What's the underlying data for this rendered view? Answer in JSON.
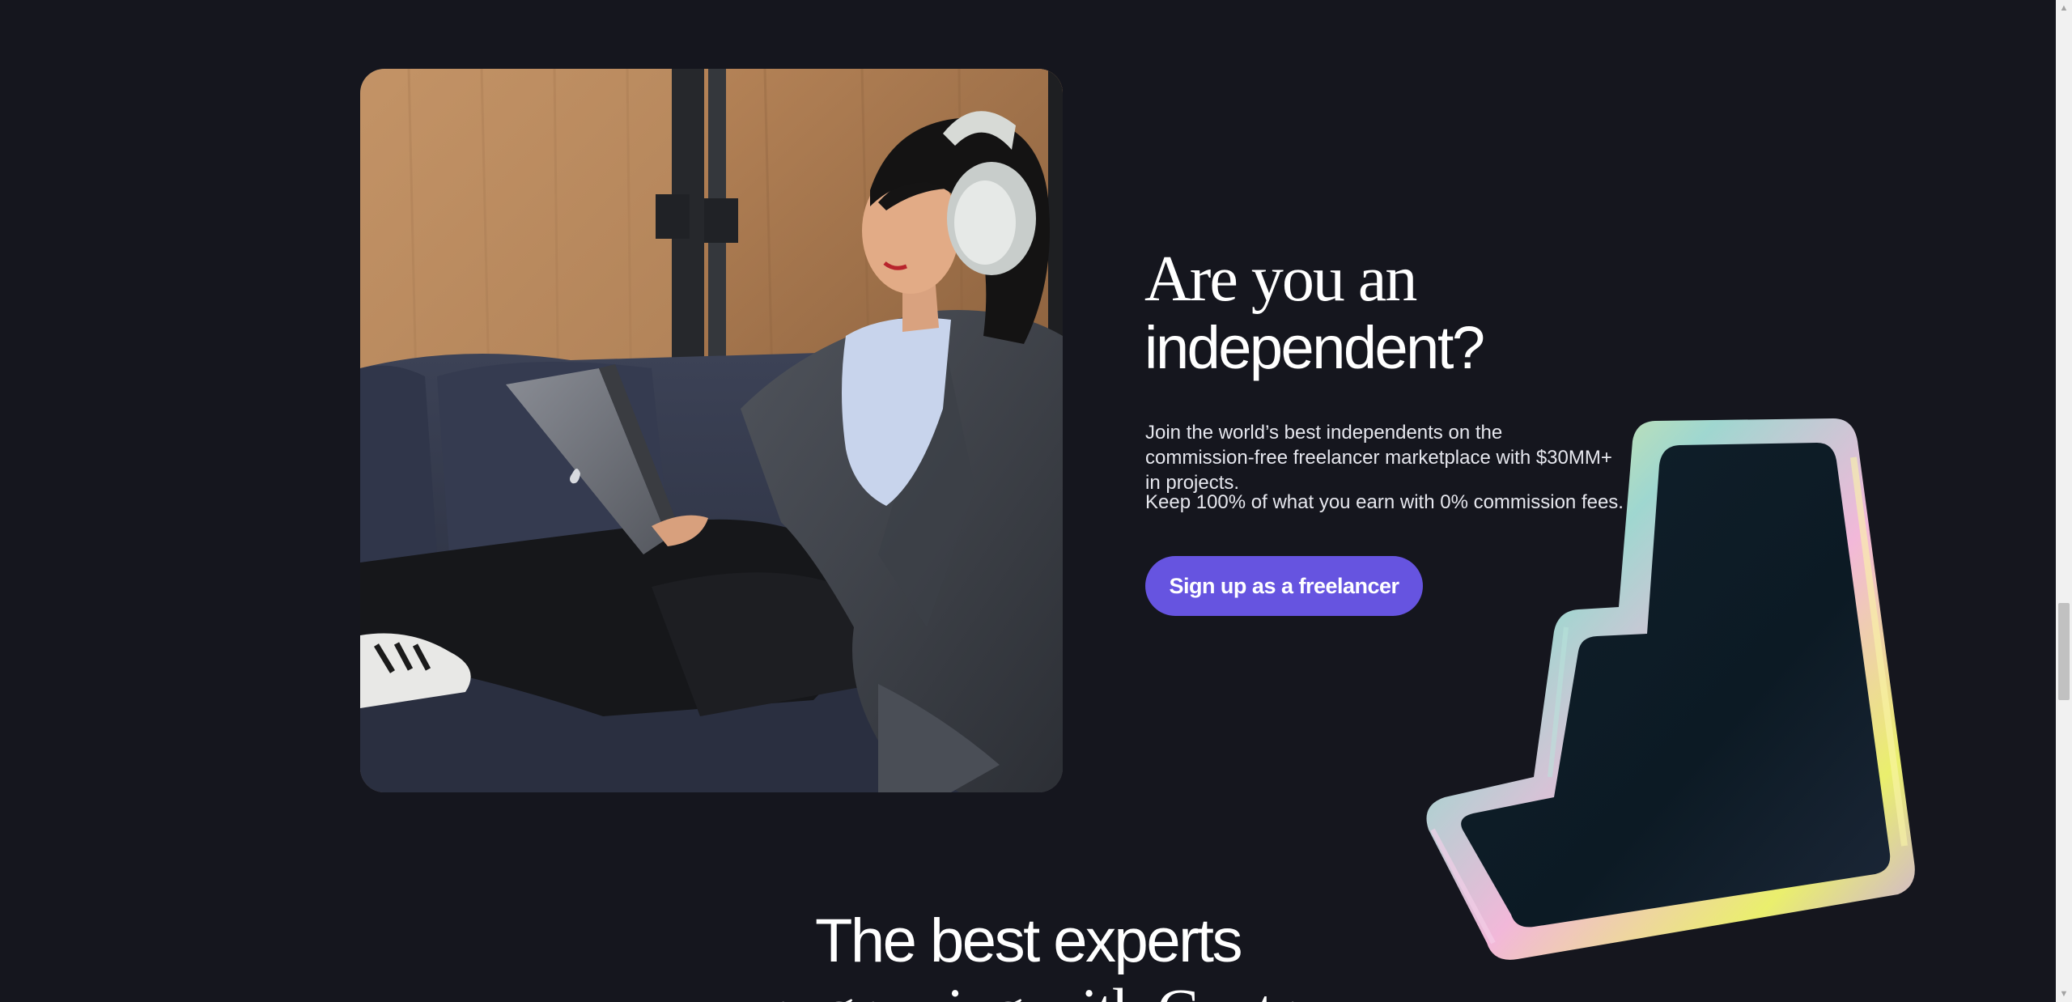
{
  "independent_section": {
    "heading_line1": "Are you an",
    "heading_line2": "independent?",
    "description": "Join the world’s best independents on the commission-free freelancer marketplace with $30MM+ in projects.",
    "fees_note": "Keep 100% of what you earn with 0% commission fees.",
    "cta_label": "Sign up as a freelancer",
    "cta_color": "#6654e0"
  },
  "experts_section": {
    "heading_line1": "The best experts",
    "heading_line2": "are growing with Contra"
  },
  "page": {
    "background_color": "#15161e"
  },
  "scrollbar": {
    "up_icon": "scroll-up-arrow-icon",
    "down_icon": "scroll-down-arrow-icon"
  }
}
